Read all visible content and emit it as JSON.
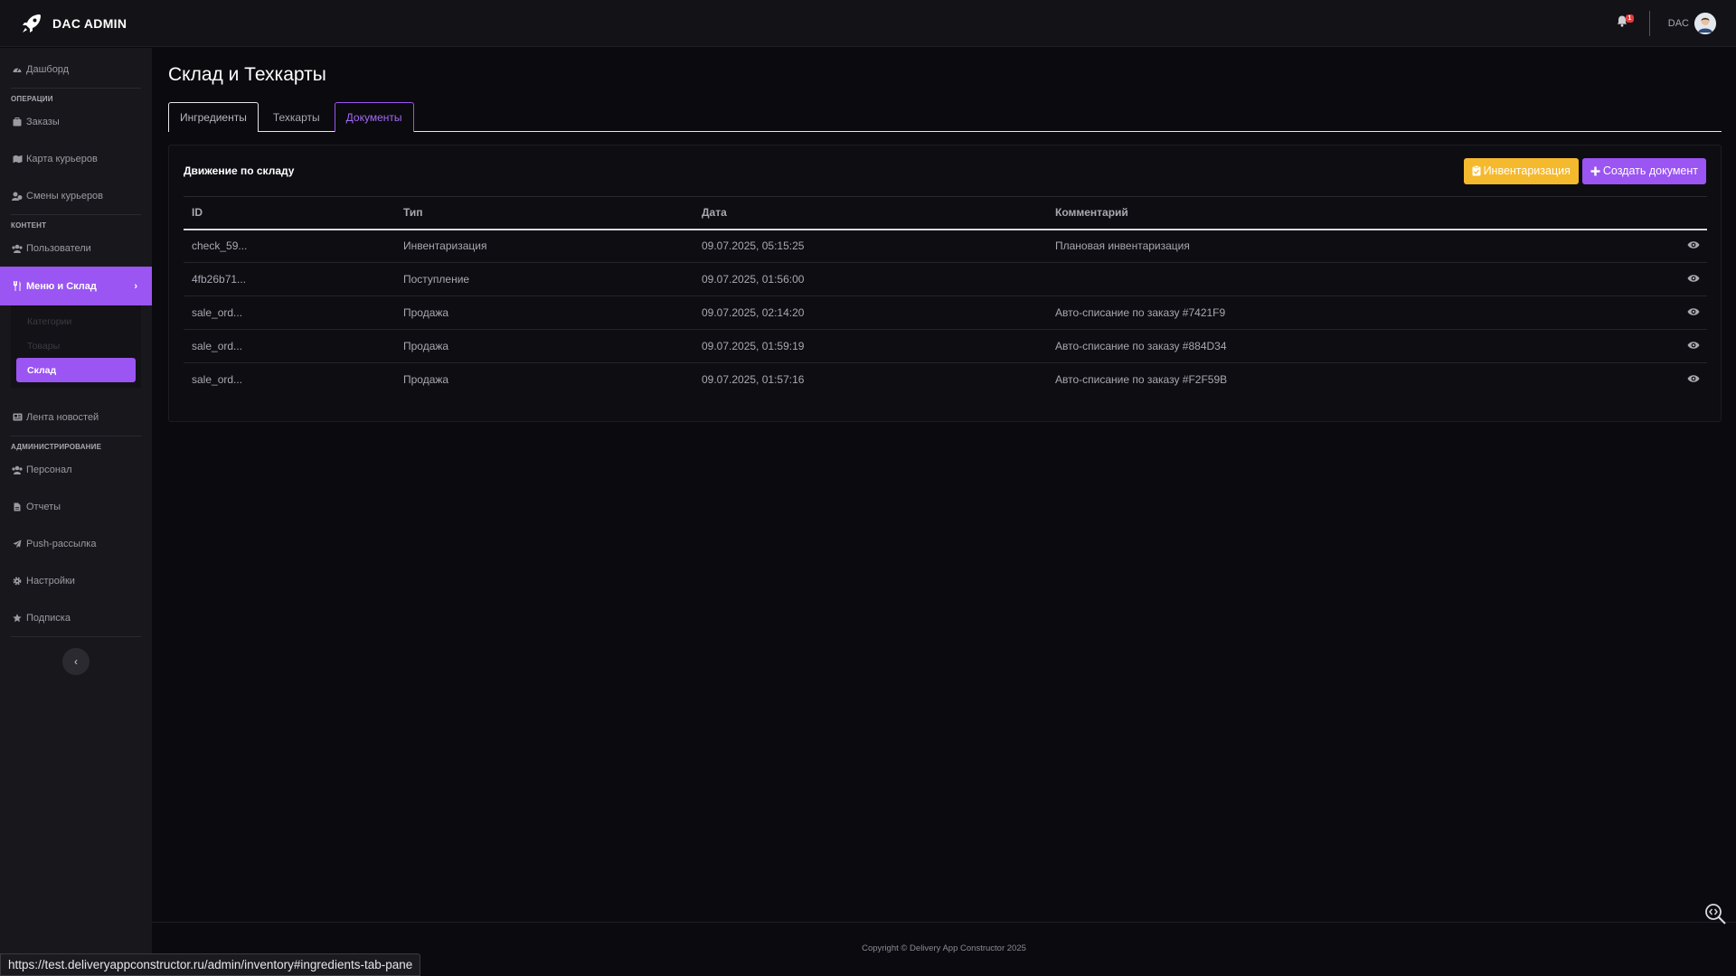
{
  "app": {
    "brand": "DAC ADMIN"
  },
  "header": {
    "notification_count": "1",
    "user_name": "DAC"
  },
  "sidebar": {
    "top_items": [
      {
        "label": "Дашборд",
        "icon": "dashboard-icon"
      }
    ],
    "sections": [
      {
        "title": "ОПЕРАЦИИ",
        "items": [
          {
            "label": "Заказы",
            "icon": "cart-icon"
          },
          {
            "label": "Карта курьеров",
            "icon": "map-icon"
          },
          {
            "label": "Смены курьеров",
            "icon": "user-clock-icon"
          }
        ]
      },
      {
        "title": "КОНТЕНТ",
        "items": [
          {
            "label": "Пользователи",
            "icon": "users-icon"
          },
          {
            "label": "Меню и Склад",
            "icon": "utensils-icon",
            "active": true
          }
        ]
      }
    ],
    "submenu": [
      {
        "label": "Категории"
      },
      {
        "label": "Товары"
      },
      {
        "label": "Склад",
        "active": true
      }
    ],
    "news_item": {
      "label": "Лента новостей",
      "icon": "newspaper-icon"
    },
    "admin_section": {
      "title": "АДМИНИСТРИРОВАНИЕ",
      "items": [
        {
          "label": "Персонал",
          "icon": "staff-icon"
        },
        {
          "label": "Отчеты",
          "icon": "file-icon"
        },
        {
          "label": "Push-рассылка",
          "icon": "paper-plane-icon"
        },
        {
          "label": "Настройки",
          "icon": "gear-icon"
        },
        {
          "label": "Подписка",
          "icon": "star-icon"
        }
      ]
    }
  },
  "page": {
    "title": "Склад и Техкарты",
    "tabs": [
      {
        "label": "Ингредиенты"
      },
      {
        "label": "Техкарты"
      },
      {
        "label": "Документы",
        "active": true
      }
    ]
  },
  "card": {
    "title": "Движение по складу",
    "inventory_button": "Инвентаризация",
    "create_button": "Создать документ",
    "columns": {
      "id": "ID",
      "type": "Тип",
      "date": "Дата",
      "comment": "Комментарий"
    },
    "rows": [
      {
        "id": "check_59...",
        "type": "Инвентаризация",
        "date": "09.07.2025, 05:15:25",
        "comment": "Плановая инвентаризация"
      },
      {
        "id": "4fb26b71...",
        "type": "Поступление",
        "date": "09.07.2025, 01:56:00",
        "comment": ""
      },
      {
        "id": "sale_ord...",
        "type": "Продажа",
        "date": "09.07.2025, 02:14:20",
        "comment": "Авто-списание по заказу #7421F9"
      },
      {
        "id": "sale_ord...",
        "type": "Продажа",
        "date": "09.07.2025, 01:59:19",
        "comment": "Авто-списание по заказу #884D34"
      },
      {
        "id": "sale_ord...",
        "type": "Продажа",
        "date": "09.07.2025, 01:57:16",
        "comment": "Авто-списание по заказу #F2F59B"
      }
    ]
  },
  "footer": {
    "copyright": "Copyright © Delivery App Constructor 2025"
  },
  "status_bar": {
    "url": "https://test.deliveryappconstructor.ru/admin/inventory#ingredients-tab-pane"
  },
  "colors": {
    "accent": "#9b55f2",
    "warning": "#f5b92e",
    "background": "#0b0a0f",
    "sidebar": "#18171c"
  }
}
